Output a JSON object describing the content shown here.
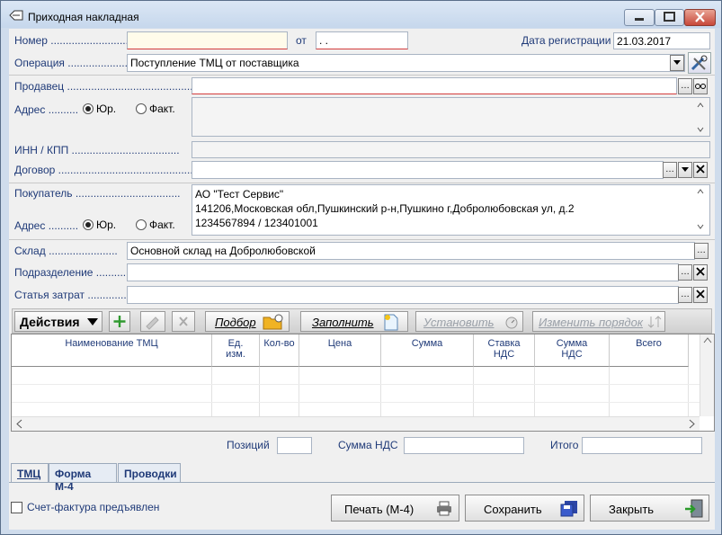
{
  "window": {
    "title": "Приходная накладная"
  },
  "header": {
    "number_label": "Номер",
    "number_value": "",
    "from_label": "от",
    "date_value": " .  .",
    "reg_date_label": "Дата регистрации",
    "reg_date_value": "21.03.2017",
    "operation_label": "Операция",
    "operation_value": "Поступление ТМЦ от поставщика"
  },
  "seller": {
    "label": "Продавец",
    "value": "",
    "address_label": "Адрес",
    "radio_jur": "Юр.",
    "radio_fact": "Факт.",
    "address_value": "",
    "inn_label": "ИНН / КПП",
    "inn_value": "",
    "contract_label": "Договор",
    "contract_value": ""
  },
  "buyer": {
    "label": "Покупатель",
    "name": "АО \"Тест Сервис\"",
    "address": "141206,Московская обл,Пушкинский р-н,Пушкино г,Добролюбовская ул, д.2",
    "inn": "1234567894 / 123401001",
    "address_label": "Адрес",
    "radio_jur": "Юр.",
    "radio_fact": "Факт."
  },
  "warehouse": {
    "label": "Склад",
    "value": "Основной склад на Добролюбовской",
    "division_label": "Подразделение",
    "division_value": "",
    "cost_label": "Статья затрат",
    "cost_value": ""
  },
  "toolbar": {
    "actions_label": "Действия",
    "pick_label": "Подбор",
    "fill_label": "Заполнить",
    "set_label": "Установить",
    "order_label": "Изменить порядок"
  },
  "grid": {
    "columns": [
      {
        "line1": "Наименование ТМЦ",
        "line2": ""
      },
      {
        "line1": "Ед.",
        "line2": "изм."
      },
      {
        "line1": "Кол-во",
        "line2": ""
      },
      {
        "line1": "Цена",
        "line2": ""
      },
      {
        "line1": "Сумма",
        "line2": ""
      },
      {
        "line1": "Ставка",
        "line2": "НДС"
      },
      {
        "line1": "Сумма",
        "line2": "НДС"
      },
      {
        "line1": "Всего",
        "line2": ""
      }
    ]
  },
  "totals": {
    "positions_label": "Позиций",
    "positions_value": "",
    "vat_label": "Сумма НДС",
    "vat_value": "",
    "total_label": "Итого",
    "total_value": ""
  },
  "tabs": [
    {
      "label": "ТМЦ"
    },
    {
      "label": "Форма М-4"
    },
    {
      "label": "Проводки"
    }
  ],
  "footer": {
    "invoice_checkbox_label": "Счет-фактура предъявлен",
    "print_label": "Печать (М-4)",
    "save_label": "Сохранить",
    "close_label": "Закрыть"
  }
}
